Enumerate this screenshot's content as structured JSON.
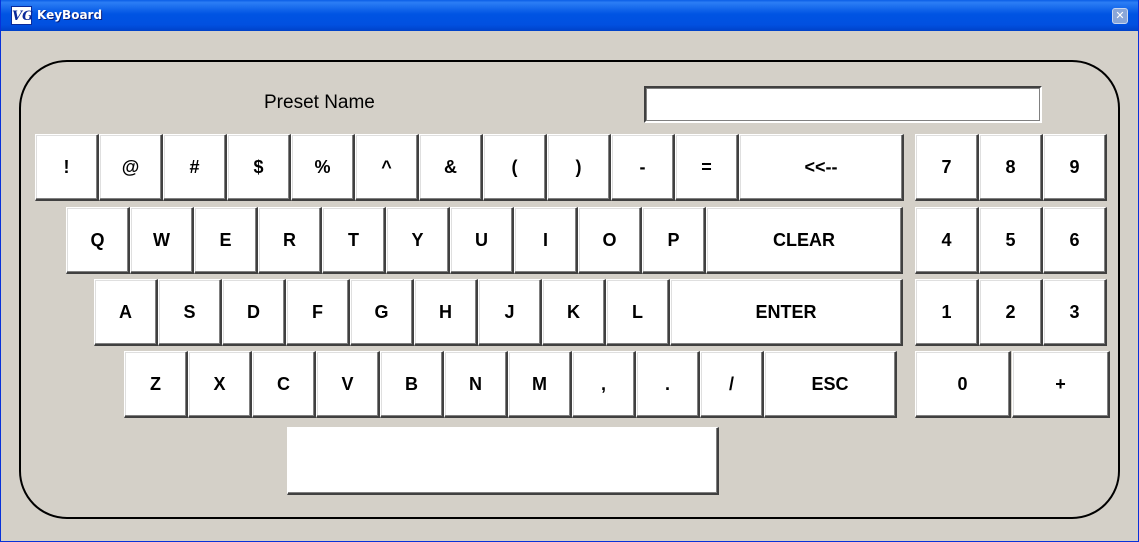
{
  "window": {
    "title": "KeyBoard",
    "icon": "VG"
  },
  "preset": {
    "label": "Preset Name",
    "value": ""
  },
  "keyboard": {
    "row1": [
      "!",
      "@",
      "#",
      "$",
      "%",
      "^",
      "&",
      "(",
      ")",
      "-",
      "=",
      "<<--"
    ],
    "row2": [
      "Q",
      "W",
      "E",
      "R",
      "T",
      "Y",
      "U",
      "I",
      "O",
      "P",
      "CLEAR"
    ],
    "row3": [
      "A",
      "S",
      "D",
      "F",
      "G",
      "H",
      "J",
      "K",
      "L",
      "ENTER"
    ],
    "row4": [
      "Z",
      "X",
      "C",
      "V",
      "B",
      "N",
      "M",
      ",",
      ".",
      "/",
      "ESC"
    ]
  },
  "numpad": {
    "row1": [
      "7",
      "8",
      "9"
    ],
    "row2": [
      "4",
      "5",
      "6"
    ],
    "row3": [
      "1",
      "2",
      "3"
    ],
    "row4": [
      "0",
      "+"
    ]
  },
  "colors": {
    "titlebar": "#0054e3",
    "window_bg": "#d4d0c8",
    "key_bg": "#ffffff"
  }
}
